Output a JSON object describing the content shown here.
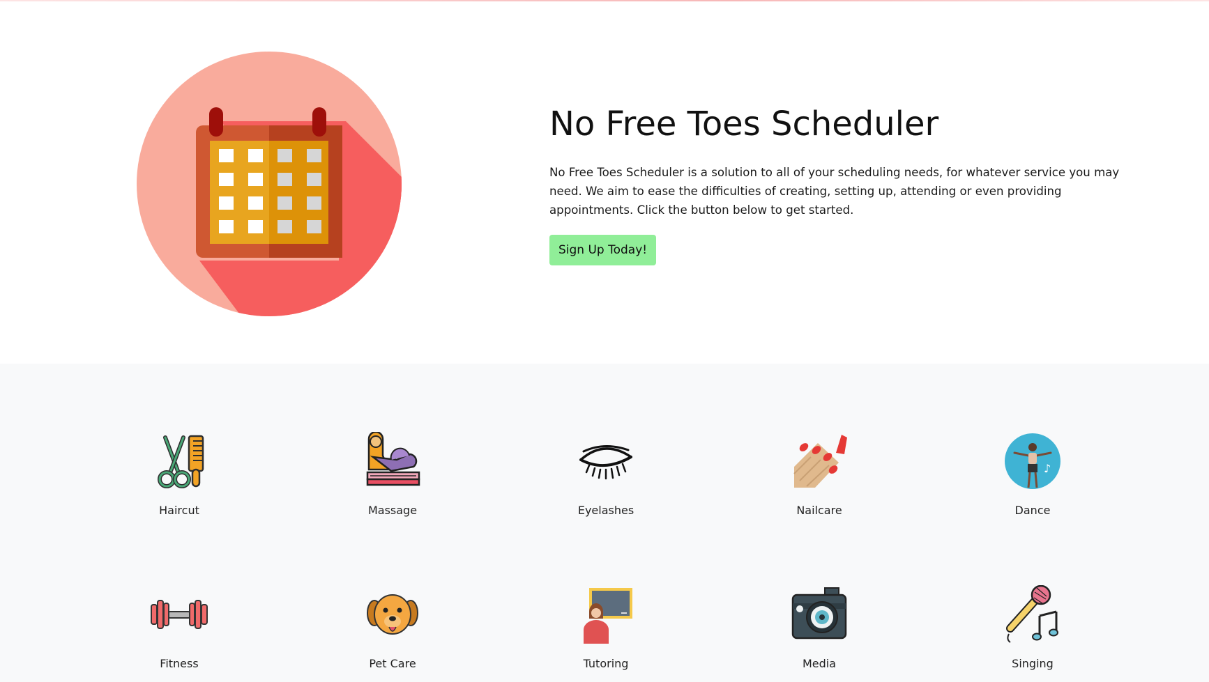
{
  "hero": {
    "title": "No Free Toes Scheduler",
    "description": "No Free Toes Scheduler is a solution to all of your scheduling needs, for whatever service you may need. We aim to ease the difficulties of creating, setting up, attending or even providing appointments. Click the button below to get started.",
    "cta_label": "Sign Up Today!",
    "illustration_icon": "calendar-icon"
  },
  "services": [
    {
      "label": "Haircut",
      "icon": "scissors-comb-icon"
    },
    {
      "label": "Massage",
      "icon": "massage-icon"
    },
    {
      "label": "Eyelashes",
      "icon": "eyelash-icon"
    },
    {
      "label": "Nailcare",
      "icon": "nail-polish-icon"
    },
    {
      "label": "Dance",
      "icon": "dancer-icon"
    },
    {
      "label": "Fitness",
      "icon": "dumbbell-icon"
    },
    {
      "label": "Pet Care",
      "icon": "dog-icon"
    },
    {
      "label": "Tutoring",
      "icon": "teacher-icon"
    },
    {
      "label": "Media",
      "icon": "camera-icon"
    },
    {
      "label": "Singing",
      "icon": "microphone-icon"
    }
  ],
  "colors": {
    "cta_bg": "#90ee98",
    "services_bg": "#f8f9fa",
    "circle_light": "#f9ab9c",
    "circle_shadow": "#f65e5e"
  }
}
